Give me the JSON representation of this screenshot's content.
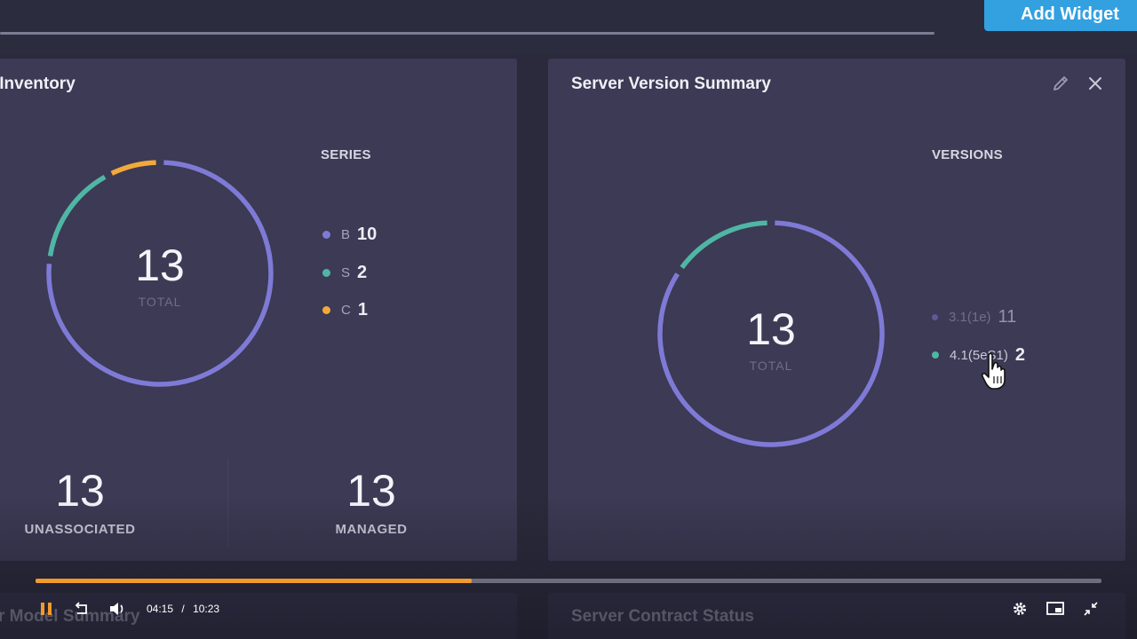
{
  "toolbar": {
    "add_widget_label": "Add Widget"
  },
  "inventory": {
    "title": "er Inventory",
    "legend_header": "SERIES",
    "total": "13",
    "total_label": "TOTAL",
    "series": [
      {
        "label": "B",
        "count": "10",
        "value": 10,
        "color": "#7f7ad6"
      },
      {
        "label": "S",
        "count": "2",
        "value": 2,
        "color": "#4fb6a6"
      },
      {
        "label": "C",
        "count": "1",
        "value": 1,
        "color": "#f2a93b"
      }
    ],
    "stats": [
      {
        "value": "13",
        "label": "UNASSOCIATED"
      },
      {
        "value": "13",
        "label": "MANAGED"
      }
    ]
  },
  "version_summary": {
    "title": "Server Version Summary",
    "legend_header": "VERSIONS",
    "total": "13",
    "total_label": "TOTAL",
    "versions": [
      {
        "label": "3.1(1e)",
        "count": "11",
        "value": 11,
        "color": "#7f7ad6"
      },
      {
        "label": "4.1(5eS1)",
        "count": "2",
        "value": 2,
        "color": "#4fb6a6"
      }
    ]
  },
  "lower_cards": {
    "left_title": "r Model Summary",
    "right_title": "Server Contract Status"
  },
  "video": {
    "current_time": "04:15",
    "separator": "/",
    "duration": "10:23",
    "progress": 0.409,
    "accent": "#f39a2d"
  },
  "icons": {
    "edit": "pencil-icon",
    "close": "close-icon",
    "pause": "pause-icon",
    "replay": "replay-10-icon",
    "volume": "volume-icon",
    "settings": "gear-icon",
    "pip": "picture-in-picture-icon",
    "fullscreen": "exit-fullscreen-icon"
  }
}
